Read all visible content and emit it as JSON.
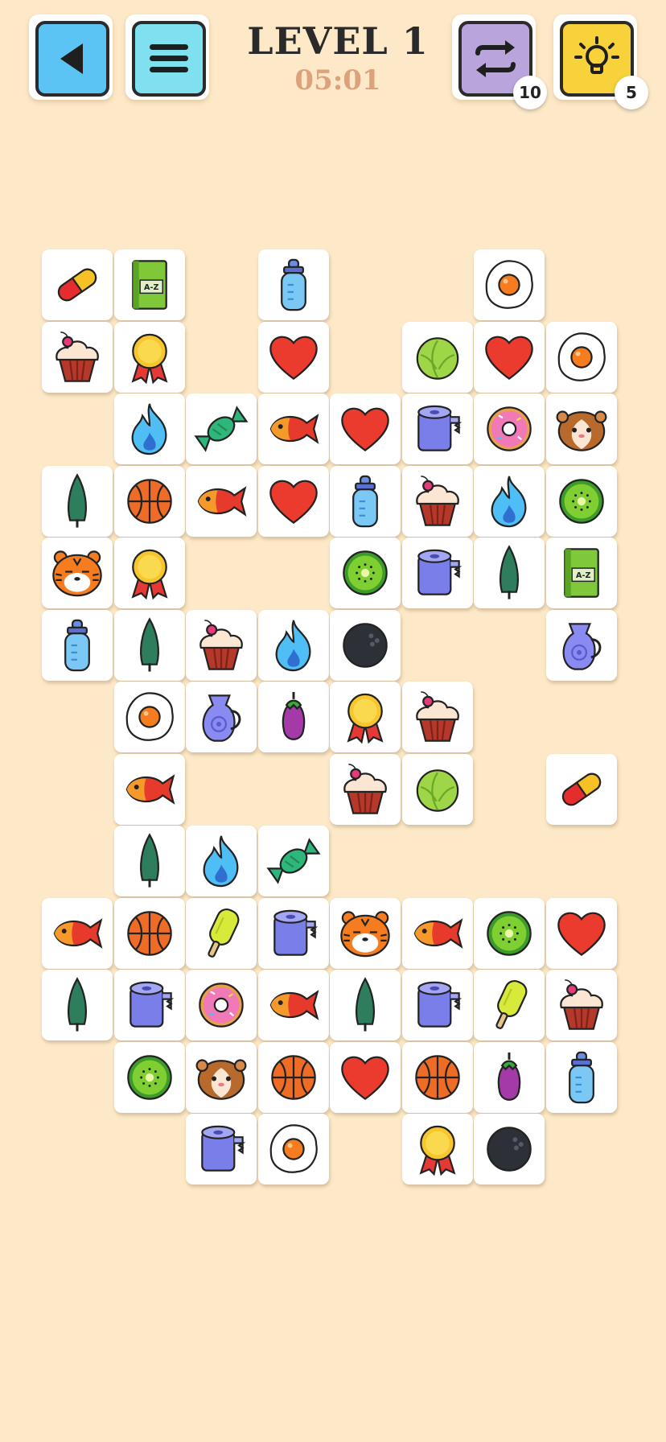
{
  "header": {
    "title": "LEVEL 1",
    "timer": "05:01",
    "shuffle_count": "10",
    "hint_count": "5"
  },
  "colors": {
    "background": "#fde9c8",
    "back_button": "#5bc4f5",
    "menu_button": "#7fe0f0",
    "shuffle_button": "#b9a5dc",
    "hint_button": "#f7d23a",
    "timer": "#dba27b"
  },
  "tiles": [
    {
      "row": 0,
      "col": 0,
      "icon": "pill-icon"
    },
    {
      "row": 0,
      "col": 1,
      "icon": "dictionary-icon"
    },
    {
      "row": 0,
      "col": 3,
      "icon": "baby-bottle-icon"
    },
    {
      "row": 0,
      "col": 6,
      "icon": "fried-egg-icon"
    },
    {
      "row": 1,
      "col": 0,
      "icon": "cupcake-icon"
    },
    {
      "row": 1,
      "col": 1,
      "icon": "medal-icon"
    },
    {
      "row": 1,
      "col": 3,
      "icon": "heart-icon"
    },
    {
      "row": 1,
      "col": 5,
      "icon": "cabbage-icon"
    },
    {
      "row": 1,
      "col": 6,
      "icon": "heart-icon"
    },
    {
      "row": 1,
      "col": 7,
      "icon": "fried-egg-icon"
    },
    {
      "row": 2,
      "col": 1,
      "icon": "flame-icon"
    },
    {
      "row": 2,
      "col": 2,
      "icon": "candy-icon"
    },
    {
      "row": 2,
      "col": 3,
      "icon": "fish-icon"
    },
    {
      "row": 2,
      "col": 4,
      "icon": "heart-icon"
    },
    {
      "row": 2,
      "col": 5,
      "icon": "toilet-paper-icon"
    },
    {
      "row": 2,
      "col": 6,
      "icon": "donut-icon"
    },
    {
      "row": 2,
      "col": 7,
      "icon": "hamster-icon"
    },
    {
      "row": 3,
      "col": 0,
      "icon": "tree-icon"
    },
    {
      "row": 3,
      "col": 1,
      "icon": "basketball-icon"
    },
    {
      "row": 3,
      "col": 2,
      "icon": "fish-icon"
    },
    {
      "row": 3,
      "col": 3,
      "icon": "heart-icon"
    },
    {
      "row": 3,
      "col": 4,
      "icon": "baby-bottle-icon"
    },
    {
      "row": 3,
      "col": 5,
      "icon": "cupcake-icon"
    },
    {
      "row": 3,
      "col": 6,
      "icon": "flame-icon"
    },
    {
      "row": 3,
      "col": 7,
      "icon": "kiwi-icon"
    },
    {
      "row": 4,
      "col": 0,
      "icon": "tiger-icon"
    },
    {
      "row": 4,
      "col": 1,
      "icon": "medal-icon"
    },
    {
      "row": 4,
      "col": 4,
      "icon": "kiwi-icon"
    },
    {
      "row": 4,
      "col": 5,
      "icon": "toilet-paper-icon"
    },
    {
      "row": 4,
      "col": 6,
      "icon": "tree-icon"
    },
    {
      "row": 4,
      "col": 7,
      "icon": "dictionary-icon"
    },
    {
      "row": 5,
      "col": 0,
      "icon": "baby-bottle-icon"
    },
    {
      "row": 5,
      "col": 1,
      "icon": "tree-icon"
    },
    {
      "row": 5,
      "col": 2,
      "icon": "cupcake-icon"
    },
    {
      "row": 5,
      "col": 3,
      "icon": "flame-icon"
    },
    {
      "row": 5,
      "col": 4,
      "icon": "bowling-ball-icon"
    },
    {
      "row": 5,
      "col": 7,
      "icon": "jug-icon"
    },
    {
      "row": 6,
      "col": 1,
      "icon": "fried-egg-icon"
    },
    {
      "row": 6,
      "col": 2,
      "icon": "jug-icon"
    },
    {
      "row": 6,
      "col": 3,
      "icon": "eggplant-icon"
    },
    {
      "row": 6,
      "col": 4,
      "icon": "medal-icon"
    },
    {
      "row": 6,
      "col": 5,
      "icon": "cupcake-icon"
    },
    {
      "row": 7,
      "col": 1,
      "icon": "fish-icon"
    },
    {
      "row": 7,
      "col": 4,
      "icon": "cupcake-icon"
    },
    {
      "row": 7,
      "col": 5,
      "icon": "cabbage-icon"
    },
    {
      "row": 7,
      "col": 7,
      "icon": "pill-icon"
    },
    {
      "row": 8,
      "col": 1,
      "icon": "tree-icon"
    },
    {
      "row": 8,
      "col": 2,
      "icon": "flame-icon"
    },
    {
      "row": 8,
      "col": 3,
      "icon": "candy-icon"
    },
    {
      "row": 9,
      "col": 0,
      "icon": "fish-icon"
    },
    {
      "row": 9,
      "col": 1,
      "icon": "basketball-icon"
    },
    {
      "row": 9,
      "col": 2,
      "icon": "popsicle-icon"
    },
    {
      "row": 9,
      "col": 3,
      "icon": "toilet-paper-icon"
    },
    {
      "row": 9,
      "col": 4,
      "icon": "tiger-icon"
    },
    {
      "row": 9,
      "col": 5,
      "icon": "fish-icon"
    },
    {
      "row": 9,
      "col": 6,
      "icon": "kiwi-icon"
    },
    {
      "row": 9,
      "col": 7,
      "icon": "heart-icon"
    },
    {
      "row": 10,
      "col": 0,
      "icon": "tree-icon"
    },
    {
      "row": 10,
      "col": 1,
      "icon": "toilet-paper-icon"
    },
    {
      "row": 10,
      "col": 2,
      "icon": "donut-icon"
    },
    {
      "row": 10,
      "col": 3,
      "icon": "fish-icon"
    },
    {
      "row": 10,
      "col": 4,
      "icon": "tree-icon"
    },
    {
      "row": 10,
      "col": 5,
      "icon": "toilet-paper-icon"
    },
    {
      "row": 10,
      "col": 6,
      "icon": "popsicle-icon"
    },
    {
      "row": 10,
      "col": 7,
      "icon": "cupcake-icon"
    },
    {
      "row": 11,
      "col": 1,
      "icon": "kiwi-icon"
    },
    {
      "row": 11,
      "col": 2,
      "icon": "hamster-icon"
    },
    {
      "row": 11,
      "col": 3,
      "icon": "basketball-icon"
    },
    {
      "row": 11,
      "col": 4,
      "icon": "heart-icon"
    },
    {
      "row": 11,
      "col": 5,
      "icon": "basketball-icon"
    },
    {
      "row": 11,
      "col": 6,
      "icon": "eggplant-icon"
    },
    {
      "row": 11,
      "col": 7,
      "icon": "baby-bottle-icon"
    },
    {
      "row": 12,
      "col": 2,
      "icon": "toilet-paper-icon"
    },
    {
      "row": 12,
      "col": 3,
      "icon": "fried-egg-icon"
    },
    {
      "row": 12,
      "col": 5,
      "icon": "medal-icon"
    },
    {
      "row": 12,
      "col": 6,
      "icon": "bowling-ball-icon"
    }
  ]
}
